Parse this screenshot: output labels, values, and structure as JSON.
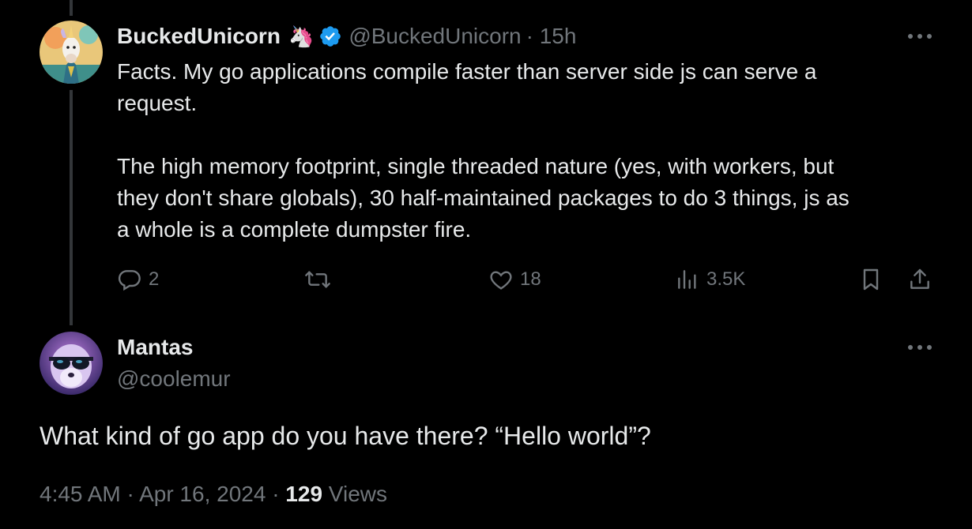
{
  "tweet1": {
    "display_name": "BuckedUnicorn",
    "handle": "@BuckedUnicorn",
    "time": "· 15h",
    "emoji": "🦄",
    "verified_color": "#1d9bf0",
    "body": "Facts. My go applications compile faster than server side js can serve a\nrequest.\n\nThe high memory footprint, single threaded nature (yes, with workers, but\nthey don't share globals), 30 half-maintained packages to do 3 things, js as\na whole is a complete dumpster fire.",
    "actions": {
      "replies": "2",
      "likes": "18",
      "views": "3.5K"
    }
  },
  "tweet2": {
    "display_name": "Mantas",
    "handle": "@coolemur",
    "body": "What kind of go app do you have there? “Hello world”?",
    "time": "4:45 AM · Apr 16, 2024 ·",
    "views_count": "129",
    "views_label": "Views"
  },
  "icons": [
    "more-icon",
    "verified-badge-icon",
    "reply-icon",
    "retweet-icon",
    "like-icon",
    "analytics-icon",
    "bookmark-icon",
    "share-icon"
  ],
  "colors": {
    "background": "#000000",
    "text": "#e7e9ea",
    "muted": "#71767b",
    "thread_line": "#333639"
  }
}
